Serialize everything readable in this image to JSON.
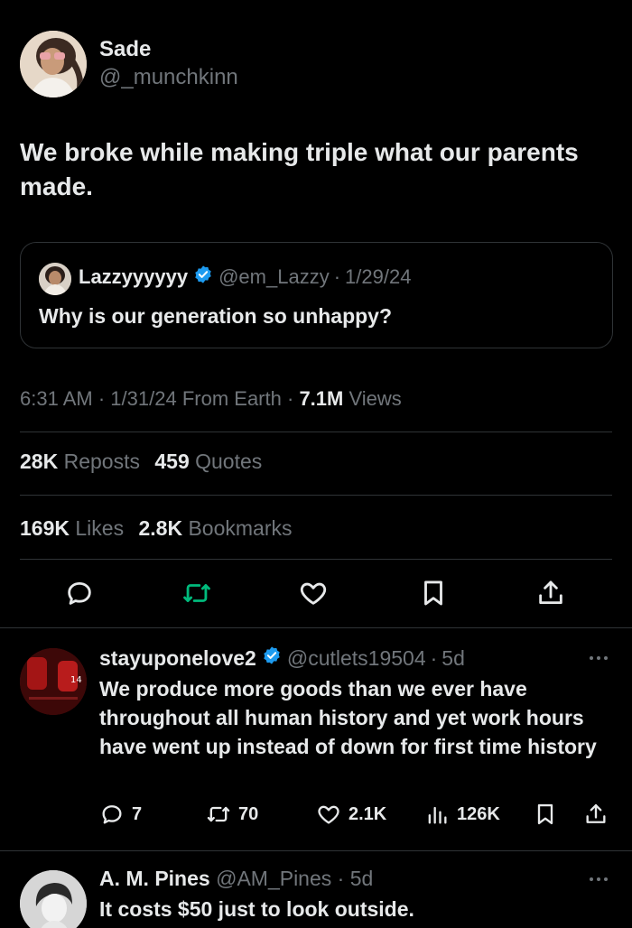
{
  "main_tweet": {
    "author_name": "Sade",
    "author_handle": "@_munchkinn",
    "text": "We broke while making triple what our parents made.",
    "quoted": {
      "author_name": "Lazzyyyyyy",
      "author_handle": "@em_Lazzy",
      "date": "1/29/24",
      "text": "Why is our generation so unhappy?"
    },
    "meta": {
      "time": "6:31 AM",
      "date": "1/31/24",
      "source": "From Earth",
      "views_count": "7.1M",
      "views_label": "Views"
    },
    "stats": {
      "reposts_count": "28K",
      "reposts_label": "Reposts",
      "quotes_count": "459",
      "quotes_label": "Quotes",
      "likes_count": "169K",
      "likes_label": "Likes",
      "bookmarks_count": "2.8K",
      "bookmarks_label": "Bookmarks"
    }
  },
  "replies": [
    {
      "author_name": "stayuponelove2",
      "author_handle": "@cutlets19504",
      "age": "5d",
      "text": "We produce more goods than we ever have throughout all human history and yet work hours have went up instead of down for first time history",
      "reply_count": "7",
      "repost_count": "70",
      "like_count": "2.1K",
      "view_count": "126K"
    },
    {
      "author_name": "A. M. Pines",
      "author_handle": "@AM_Pines",
      "age": "5d",
      "text": "It costs $50 just to look outside."
    }
  ],
  "colors": {
    "background": "#000000",
    "text": "#e7e9ea",
    "muted": "#71767b",
    "divider": "#2f3336",
    "verified": "#1d9bf0",
    "repost_active": "#00ba7c"
  },
  "icons": [
    "reply-icon",
    "repost-icon",
    "like-icon",
    "bookmark-icon",
    "share-icon",
    "views-icon",
    "verified-icon",
    "more-icon"
  ]
}
